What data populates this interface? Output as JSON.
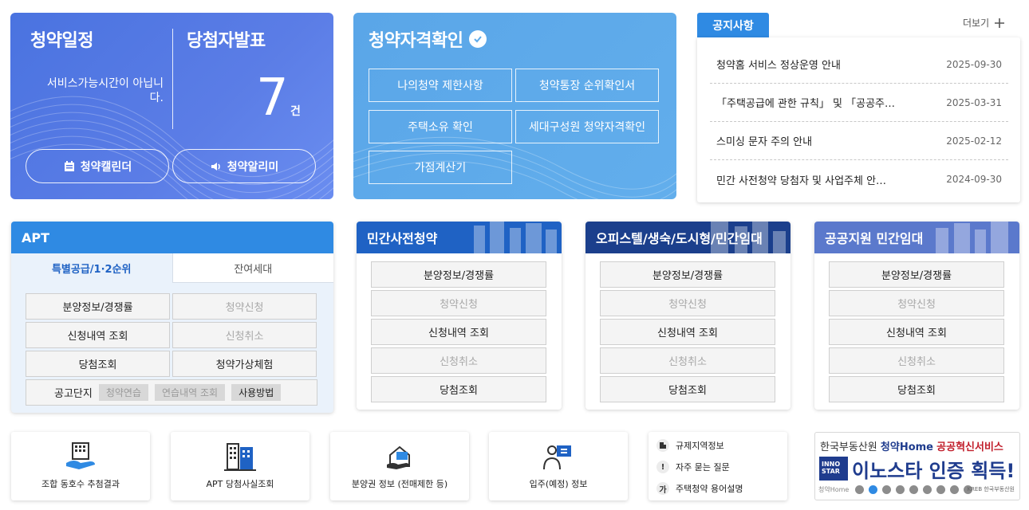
{
  "schedule": {
    "title": "청약일정",
    "message": "서비스가능시간이 아닙니다.",
    "calendar_btn": "청약캘린더",
    "alarm_btn": "청약알리미"
  },
  "winner": {
    "title": "당첨자발표",
    "count": "7",
    "unit": "건"
  },
  "eligibility": {
    "title": "청약자격확인",
    "buttons": [
      "나의청약 제한사항",
      "청약통장 순위확인서",
      "주택소유 확인",
      "세대구성원 청약자격확인",
      "가점계산기"
    ]
  },
  "notice": {
    "tab": "공지사항",
    "more": "더보기",
    "items": [
      {
        "title": "청약홈 서비스 정상운영 안내",
        "date": "2025-09-30"
      },
      {
        "title": "「주택공급에 관한 규칙」 및 「공공주…",
        "date": "2025-03-31"
      },
      {
        "title": "스미싱 문자 주의 안내",
        "date": "2025-02-12"
      },
      {
        "title": "민간 사전청약 당첨자 및 사업주체 안…",
        "date": "2024-09-30"
      }
    ]
  },
  "apt": {
    "title": "APT",
    "tabs": [
      "특별공급/1·2순위",
      "잔여세대"
    ],
    "buttons": [
      "분양정보/경쟁률",
      "청약신청",
      "신청내역 조회",
      "신청취소",
      "당첨조회",
      "청약가상체험"
    ],
    "complex_label": "공고단지",
    "complex_buttons": [
      "청약연습",
      "연습내역 조회",
      "사용방법"
    ]
  },
  "private_pre": {
    "title": "민간사전청약",
    "buttons": [
      "분양정보/경쟁률",
      "청약신청",
      "신청내역 조회",
      "신청취소",
      "당첨조회"
    ]
  },
  "officetel": {
    "title": "오피스텔/생숙/도시형/민간임대",
    "buttons": [
      "분양정보/경쟁률",
      "청약신청",
      "신청내역 조회",
      "신청취소",
      "당첨조회"
    ]
  },
  "public_rental": {
    "title": "공공지원 민간임대",
    "buttons": [
      "분양정보/경쟁률",
      "청약신청",
      "신청내역 조회",
      "신청취소",
      "당첨조회"
    ]
  },
  "quick_links": [
    "조합 동호수 추첨결과",
    "APT 당첨사실조회",
    "분양권 정보 (전매제한 등)",
    "입주(예정) 정보"
  ],
  "info_links": [
    {
      "icon": "building-icon",
      "label": "규제지역정보"
    },
    {
      "icon": "exclamation-icon",
      "label": "자주 묻는 질문"
    },
    {
      "icon": "ga-icon",
      "glyph": "가",
      "label": "주택청약 용어설명"
    }
  ],
  "banner": {
    "org": "한국부동산원",
    "brand": "청약Home",
    "service": "공공혁신서비스",
    "badge": "INNO STAR",
    "headline": "이노스타 인증 획득!",
    "footer_left": "청약Home",
    "footer_right": "KREB 한국부동산원"
  },
  "colors": {
    "schedule_bg": "#5577e3",
    "eligibility_bg": "#5eaaea",
    "notice_tab": "#2f8ae3",
    "apt_head": "#2f8ae3",
    "private_pre_head": "#1f62c4",
    "officetel_head": "#1b3f8c",
    "public_rental_head": "#5b79cc"
  }
}
